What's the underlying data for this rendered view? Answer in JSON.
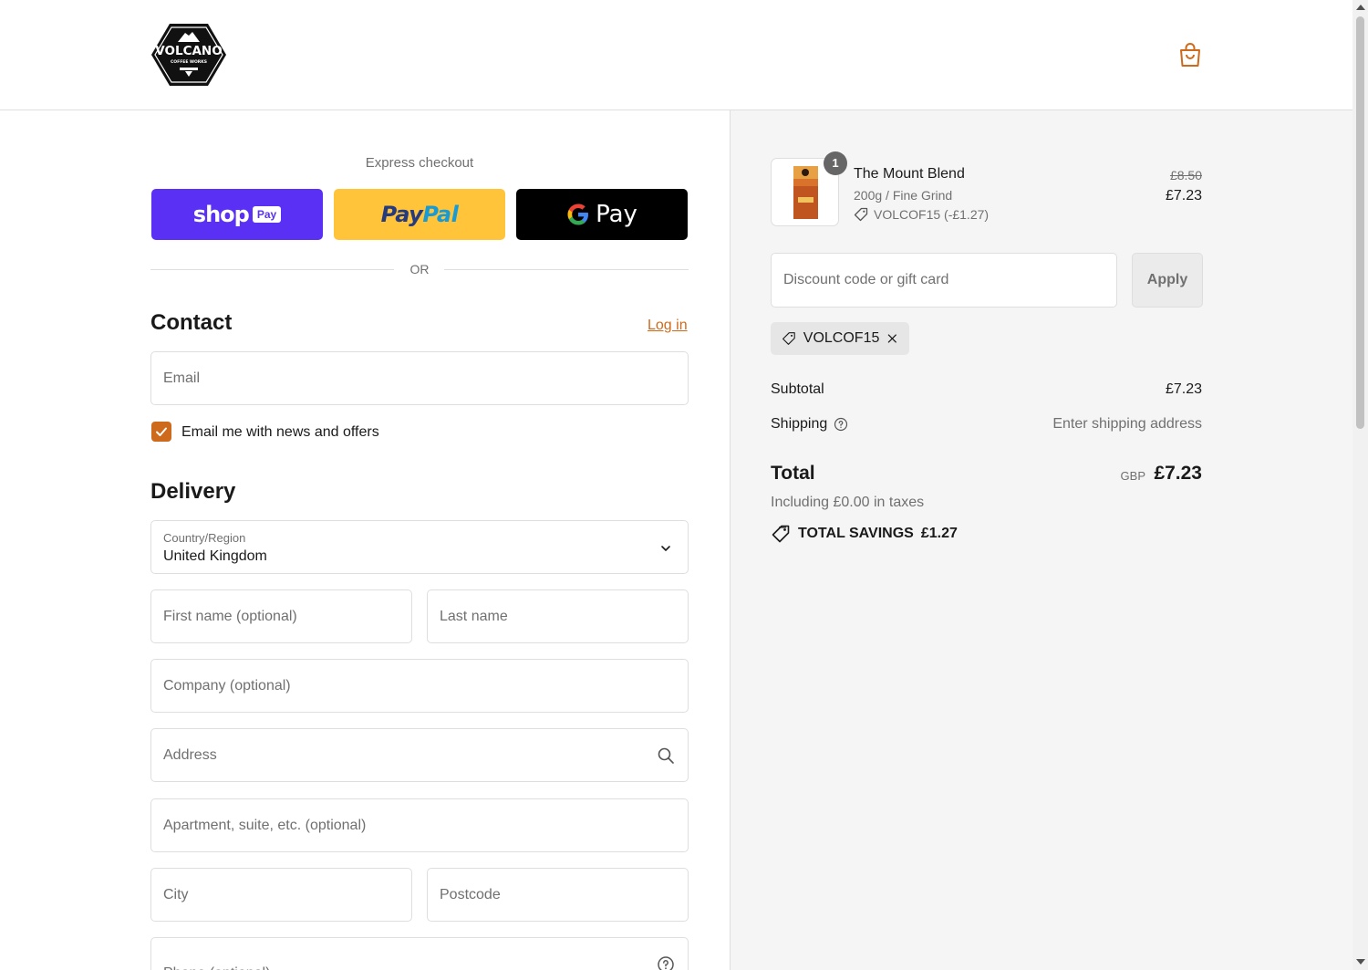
{
  "brand": {
    "logo_text": "VOLCANO",
    "logo_subtext": "COFFEE WORKS",
    "accent": "#ce6a1c"
  },
  "express": {
    "label": "Express checkout",
    "shop_pay": {
      "word": "shop",
      "pill": "Pay"
    },
    "paypal": {
      "part1": "Pay",
      "part2": "Pal"
    },
    "gpay": {
      "g": "G",
      "word": "Pay"
    }
  },
  "or_text": "OR",
  "contact": {
    "title": "Contact",
    "login_label": "Log in",
    "email_placeholder": "Email",
    "newsletter_label": "Email me with news and offers",
    "newsletter_checked": true
  },
  "delivery": {
    "title": "Delivery",
    "country_label": "Country/Region",
    "country_value": "United Kingdom",
    "first_name_placeholder": "First name (optional)",
    "last_name_placeholder": "Last name",
    "company_placeholder": "Company (optional)",
    "address_placeholder": "Address",
    "apartment_placeholder": "Apartment, suite, etc. (optional)",
    "city_placeholder": "City",
    "postcode_placeholder": "Postcode",
    "phone_placeholder": "Phone (optional)"
  },
  "summary": {
    "item": {
      "quantity": "1",
      "name": "The Mount Blend",
      "variant": "200g / Fine Grind",
      "discount": "VOLCOF15 (-£1.27)",
      "price_old": "£8.50",
      "price_new": "£7.23"
    },
    "discount_placeholder": "Discount code or gift card",
    "apply_label": "Apply",
    "applied_code": "VOLCOF15",
    "subtotal_label": "Subtotal",
    "subtotal_value": "£7.23",
    "shipping_label": "Shipping",
    "shipping_value": "Enter shipping address",
    "total_label": "Total",
    "currency": "GBP",
    "total_value": "£7.23",
    "taxes_text": "Including £0.00 in taxes",
    "savings_label": "TOTAL SAVINGS",
    "savings_value": "£1.27"
  }
}
